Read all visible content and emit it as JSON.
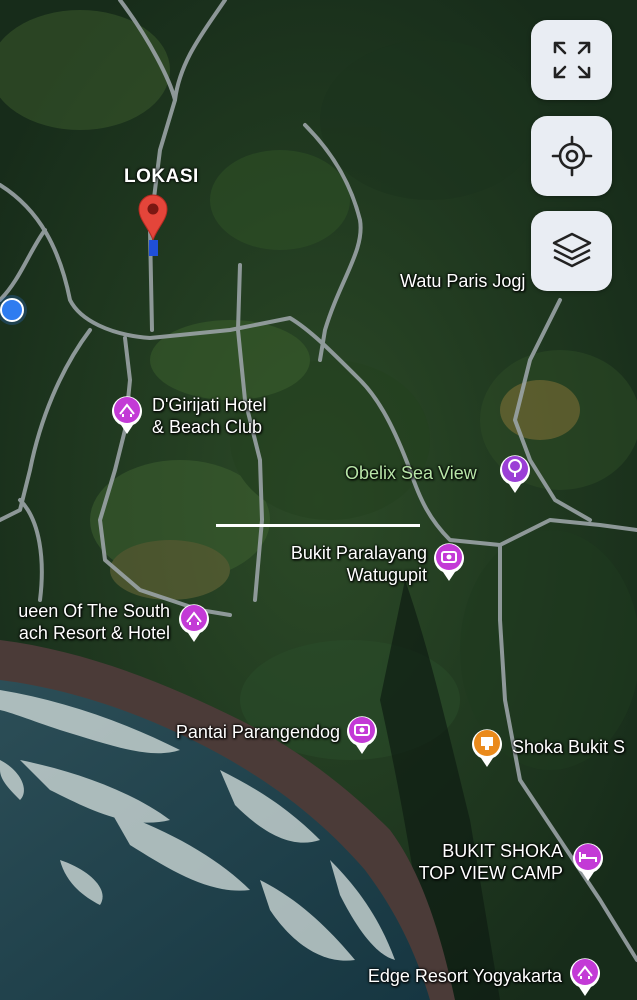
{
  "map": {
    "type": "satellite",
    "marker_label": "LOKASI",
    "places": [
      {
        "name": "D'Girijati Hotel",
        "name2": "& Beach Club",
        "icon": "hotel-icon",
        "color": "#c33ad6"
      },
      {
        "name": "Watu Paris Jogj",
        "icon": "",
        "color": ""
      },
      {
        "name": "Obelix Sea View",
        "icon": "tree-icon",
        "color": "#9b3fd6"
      },
      {
        "name": "Bukit Paralayang",
        "name2": "Watugupit",
        "icon": "camera-icon",
        "color": "#c33ad6"
      },
      {
        "name": "ueen Of The South",
        "name2": "ach Resort & Hotel",
        "icon": "hotel-icon",
        "color": "#c33ad6"
      },
      {
        "name": "Pantai Parangendog",
        "icon": "camera-icon",
        "color": "#c33ad6"
      },
      {
        "name": "Shoka Bukit S",
        "icon": "restaurant-icon",
        "color": "#ea8a1c"
      },
      {
        "name": "BUKIT SHOKA",
        "name2": "TOP VIEW CAMP",
        "icon": "bed-icon",
        "color": "#c33ad6"
      },
      {
        "name": "Edge Resort Yogyakarta",
        "icon": "hotel-icon",
        "color": "#c33ad6"
      }
    ]
  },
  "controls": {
    "fullscreen": "expand-icon",
    "locate": "crosshair-icon",
    "layers": "layers-icon"
  },
  "colors": {
    "poi_purple": "#c33ad6",
    "poi_orange": "#ea8a1c",
    "marker_red": "#e4453a",
    "user_dot": "#2f7cf0"
  }
}
